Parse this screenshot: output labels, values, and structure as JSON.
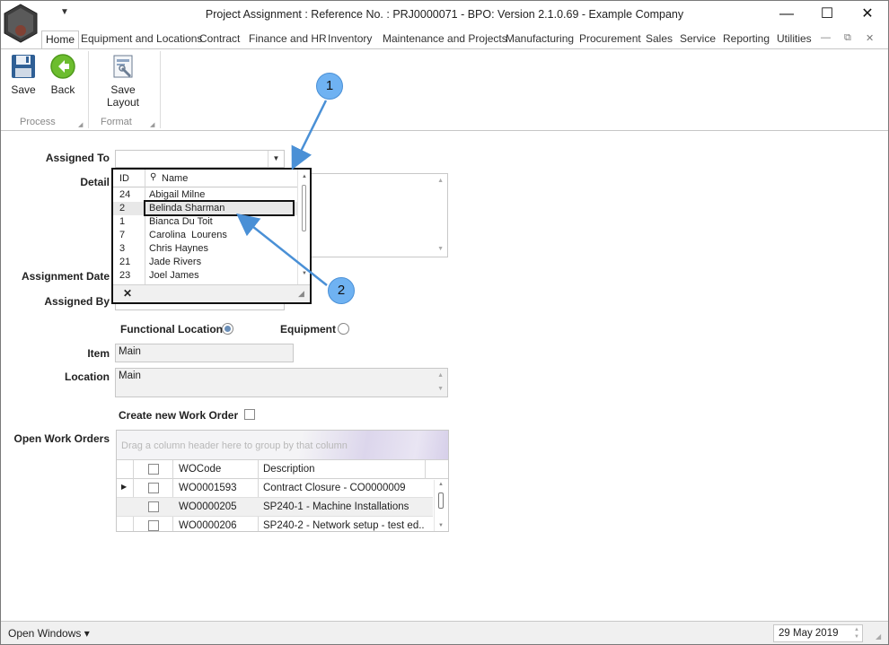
{
  "titlebar": {
    "title": "Project Assignment : Reference No. : PRJ0000071 - BPO: Version 2.1.0.69 - Example Company",
    "logo_text": "BPO",
    "qat_icon": "chevron-down-icon",
    "minimize_glyph": "—",
    "maximize_glyph": "☐",
    "close_glyph": "✕"
  },
  "tabs": [
    "Home",
    "Equipment and Locations",
    "Contract",
    "Finance and HR",
    "Inventory",
    "Maintenance and Projects",
    "Manufacturing",
    "Procurement",
    "Sales",
    "Service",
    "Reporting",
    "Utilities"
  ],
  "mdi": {
    "restore_glyph": "▫",
    "close_glyph": "✕"
  },
  "ribbon": {
    "save_label": "Save",
    "back_label": "Back",
    "save_layout_label": "Save Layout",
    "process_group": "Process",
    "format_group": "Format"
  },
  "form": {
    "assigned_to_label": "Assigned To",
    "assigned_to_value": "",
    "detail_label": "Detail",
    "assignment_date_label": "Assignment Date",
    "assigned_by_label": "Assigned By",
    "functional_location_label": "Functional Location",
    "equipment_label": "Equipment",
    "item_label": "Item",
    "item_value": "Main",
    "location_label": "Location",
    "location_value": "Main",
    "create_wo_label": "Create new Work Order",
    "open_wo_label": "Open Work Orders"
  },
  "grid": {
    "group_hint": "Drag a column header here to group by that column",
    "columns": [
      "WOCode",
      "Description"
    ],
    "rows": [
      {
        "code": "WO0001593",
        "description": "Contract Closure - CO0000009"
      },
      {
        "code": "WO0000205",
        "description": "SP240-1 - Machine Installations"
      },
      {
        "code": "WO0000206",
        "description": "SP240-2 - Network setup - test ed..."
      }
    ]
  },
  "dropdown": {
    "col_id": "ID",
    "col_name": "Name",
    "search_icon": "binoculars-icon",
    "clear_glyph": "✕",
    "rows": [
      {
        "id": "24",
        "name": "Abigail Milne"
      },
      {
        "id": "2",
        "name": "Belinda Sharman"
      },
      {
        "id": "1",
        "name": "Bianca Du Toit"
      },
      {
        "id": "7",
        "name": "Carolina  Lourens"
      },
      {
        "id": "3",
        "name": "Chris Haynes"
      },
      {
        "id": "21",
        "name": "Jade Rivers"
      },
      {
        "id": "23",
        "name": "Joel James"
      }
    ]
  },
  "callouts": {
    "one": "1",
    "two": "2"
  },
  "statusbar": {
    "open_windows": "Open Windows ▾",
    "date": "29 May 2019"
  },
  "colors": {
    "callout": "#6fb2f2",
    "arrow": "#4a90d6",
    "save_icon": "#2f5f95",
    "back_icon": "#6cbd2e"
  }
}
